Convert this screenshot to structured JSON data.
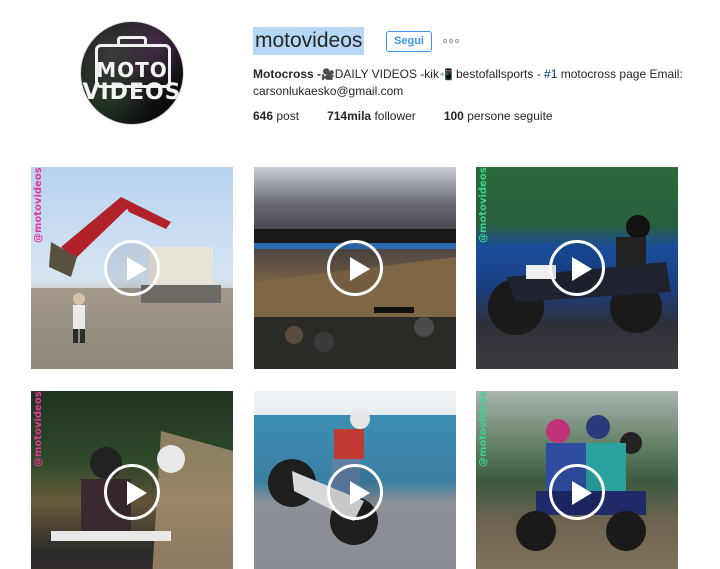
{
  "profile": {
    "username": "motovideos",
    "avatar_text_top": "MOTO",
    "avatar_text_bottom": "VIDEOS",
    "follow_label": "Segui",
    "more_icon": "ellipsis-icon",
    "bio": {
      "name": "Motocross -",
      "text_1": "DAILY VIDEOS -kik",
      "text_2": " bestofallsports - ",
      "hashtag": "#1",
      "text_3": " motocross page Email: carsonlukaesko@gmail.com",
      "emoji_1": "🎥",
      "emoji_2": "📲"
    },
    "stats": {
      "posts_num": "646",
      "posts_label": "post",
      "followers_num": "714mila",
      "followers_label": "follower",
      "following_num": "100",
      "following_label": "persone seguite"
    }
  },
  "posts": {
    "watermark": "@motovideos",
    "play_icon": "play-icon",
    "colors": {
      "accent": "#3897f0",
      "watermark_pink": "#e8379a",
      "watermark_green": "#39d48f"
    },
    "items": [
      {
        "id": "post-1",
        "type": "video",
        "watermark": "@motovideos"
      },
      {
        "id": "post-2",
        "type": "video"
      },
      {
        "id": "post-3",
        "type": "video",
        "watermark": "@motovideos"
      },
      {
        "id": "post-4",
        "type": "video",
        "watermark": "@motovideos"
      },
      {
        "id": "post-5",
        "type": "video"
      },
      {
        "id": "post-6",
        "type": "video",
        "watermark": "@motovideos"
      }
    ]
  }
}
